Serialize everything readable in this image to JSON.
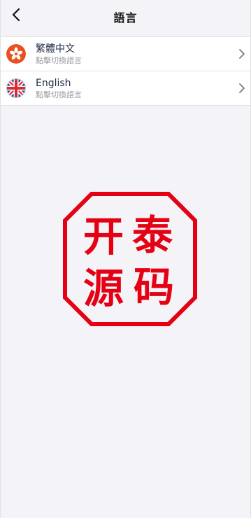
{
  "header": {
    "title": "語言"
  },
  "languages": [
    {
      "label": "繁體中文",
      "subtitle": "點擊切換語言",
      "flag_icon": "hong-kong-flag-icon"
    },
    {
      "label": "English",
      "subtitle": "點擊切換語言",
      "flag_icon": "uk-flag-icon"
    }
  ],
  "watermark": {
    "chars": [
      "开",
      "泰",
      "源",
      "码"
    ],
    "color": "#e50014"
  },
  "colors": {
    "background": "#f4f3f7",
    "row_background": "#ffffff",
    "title_text": "#111111",
    "label_text": "#1f2a44",
    "subtitle_text": "#9a9aa2",
    "seal_red": "#e50014"
  }
}
